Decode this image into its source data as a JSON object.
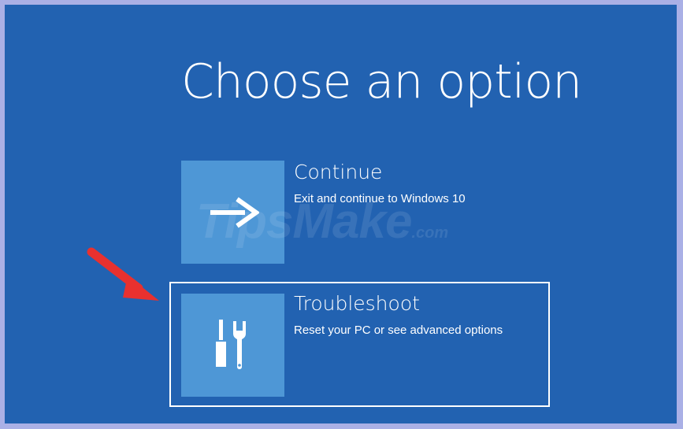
{
  "screen": {
    "title": "Choose an option",
    "background_color": "#2262b1",
    "tile_color": "#4e97d6"
  },
  "options": [
    {
      "title": "Continue",
      "description": "Exit and continue to Windows 10",
      "icon": "arrow-right-icon",
      "selected": false
    },
    {
      "title": "Troubleshoot",
      "description": "Reset your PC or see advanced options",
      "icon": "tools-icon",
      "selected": true
    }
  ],
  "watermark": {
    "brand": "TipsMake",
    "suffix": ".com"
  },
  "annotation": {
    "arrow_color": "#e8312f",
    "points_to": "Troubleshoot"
  }
}
